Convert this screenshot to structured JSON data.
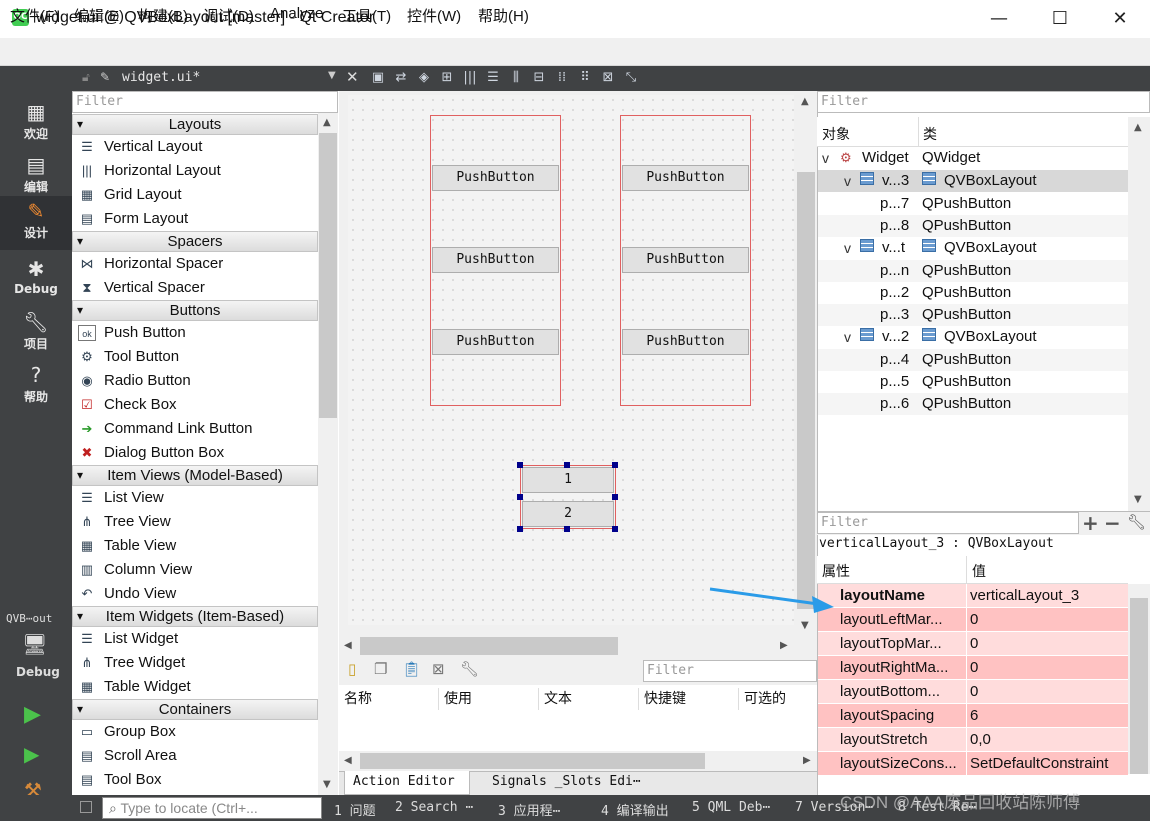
{
  "window": {
    "title": "widget.ui @ QVBoxLayout [master] - Qt Creator",
    "logo": "QC",
    "minimize": "—",
    "maximize": "☐",
    "close": "✕"
  },
  "menu": [
    "文件(F)",
    "编辑(E)",
    "构建(B)",
    "调试(D)",
    "Analyze",
    "工具(T)",
    "控件(W)",
    "帮助(H)"
  ],
  "doc_tab": "widget.ui*",
  "modes": [
    {
      "label": "欢迎",
      "icon": "grid-icon"
    },
    {
      "label": "编辑",
      "icon": "edit-doc-icon"
    },
    {
      "label": "设计",
      "icon": "pencil-icon"
    },
    {
      "label": "Debug",
      "icon": "bug-icon"
    },
    {
      "label": "项目",
      "icon": "wrench-icon"
    },
    {
      "label": "帮助",
      "icon": "help-icon"
    }
  ],
  "kit": {
    "name": "QVB⋯out",
    "label": "Debug"
  },
  "widget_box": {
    "filter_placeholder": "Filter",
    "categories": [
      {
        "name": "Layouts",
        "items": [
          "Vertical Layout",
          "Horizontal Layout",
          "Grid Layout",
          "Form Layout"
        ]
      },
      {
        "name": "Spacers",
        "items": [
          "Horizontal Spacer",
          "Vertical Spacer"
        ]
      },
      {
        "name": "Buttons",
        "items": [
          "Push Button",
          "Tool Button",
          "Radio Button",
          "Check Box",
          "Command Link Button",
          "Dialog Button Box"
        ]
      },
      {
        "name": "Item Views (Model-Based)",
        "items": [
          "List View",
          "Tree View",
          "Table View",
          "Column View",
          "Undo View"
        ]
      },
      {
        "name": "Item Widgets (Item-Based)",
        "items": [
          "List Widget",
          "Tree Widget",
          "Table Widget"
        ]
      },
      {
        "name": "Containers",
        "items": [
          "Group Box",
          "Scroll Area",
          "Tool Box"
        ]
      }
    ]
  },
  "canvas": {
    "push_button_label": "PushButton",
    "selected_buttons": [
      "1",
      "2"
    ]
  },
  "action_editor": {
    "filter_placeholder": "Filter",
    "columns": [
      "名称",
      "使用",
      "文本",
      "快捷键",
      "可选的"
    ],
    "tabs": [
      "Action Editor",
      "Signals _Slots Edi⋯"
    ]
  },
  "object_inspector": {
    "filter_placeholder": "Filter",
    "columns": [
      "对象",
      "类"
    ],
    "rows": [
      {
        "name": "Widget",
        "class": "QWidget",
        "level": 0,
        "expand": "▾",
        "icon": "widget-icon"
      },
      {
        "name": "v...3",
        "class": "QVBoxLayout",
        "level": 1,
        "expand": "▾",
        "icon": "layout-icon",
        "selected": true
      },
      {
        "name": "p...7",
        "class": "QPushButton",
        "level": 2
      },
      {
        "name": "p...8",
        "class": "QPushButton",
        "level": 2
      },
      {
        "name": "v...t",
        "class": "QVBoxLayout",
        "level": 1,
        "expand": "▾",
        "icon": "layout-icon"
      },
      {
        "name": "p...n",
        "class": "QPushButton",
        "level": 2
      },
      {
        "name": "p...2",
        "class": "QPushButton",
        "level": 2
      },
      {
        "name": "p...3",
        "class": "QPushButton",
        "level": 2
      },
      {
        "name": "v...2",
        "class": "QVBoxLayout",
        "level": 1,
        "expand": "▾",
        "icon": "layout-icon"
      },
      {
        "name": "p...4",
        "class": "QPushButton",
        "level": 2
      },
      {
        "name": "p...5",
        "class": "QPushButton",
        "level": 2
      },
      {
        "name": "p...6",
        "class": "QPushButton",
        "level": 2
      }
    ]
  },
  "property_editor": {
    "filter_placeholder": "Filter",
    "caption": "verticalLayout_3 : QVBoxLayout",
    "columns": [
      "属性",
      "值"
    ],
    "rows": [
      {
        "name": "layoutName",
        "value": "verticalLayout_3",
        "bold": true
      },
      {
        "name": "layoutLeftMar...",
        "value": "0"
      },
      {
        "name": "layoutTopMar...",
        "value": "0"
      },
      {
        "name": "layoutRightMa...",
        "value": "0"
      },
      {
        "name": "layoutBottom...",
        "value": "0"
      },
      {
        "name": "layoutSpacing",
        "value": "6"
      },
      {
        "name": "layoutStretch",
        "value": "0,0"
      },
      {
        "name": "layoutSizeCons...",
        "value": "SetDefaultConstraint"
      }
    ],
    "row_colors": [
      "#ffdcdc",
      "#ffc2c2"
    ]
  },
  "statusbar": {
    "locate_placeholder": "Type to locate (Ctrl+...",
    "panes": [
      "1 问题",
      "2 Search ⋯",
      "3 应用程⋯",
      "4 编译输出",
      "5 QML Deb⋯",
      "7 Version⋯",
      "8 Test Re⋯"
    ]
  },
  "watermark": "CSDN @AAA废品回收站陈师傅",
  "colors": {
    "dark_chrome": "#404244",
    "layout_border": "#e06060",
    "handle": "#00008b",
    "arrow": "#2a9be8"
  }
}
